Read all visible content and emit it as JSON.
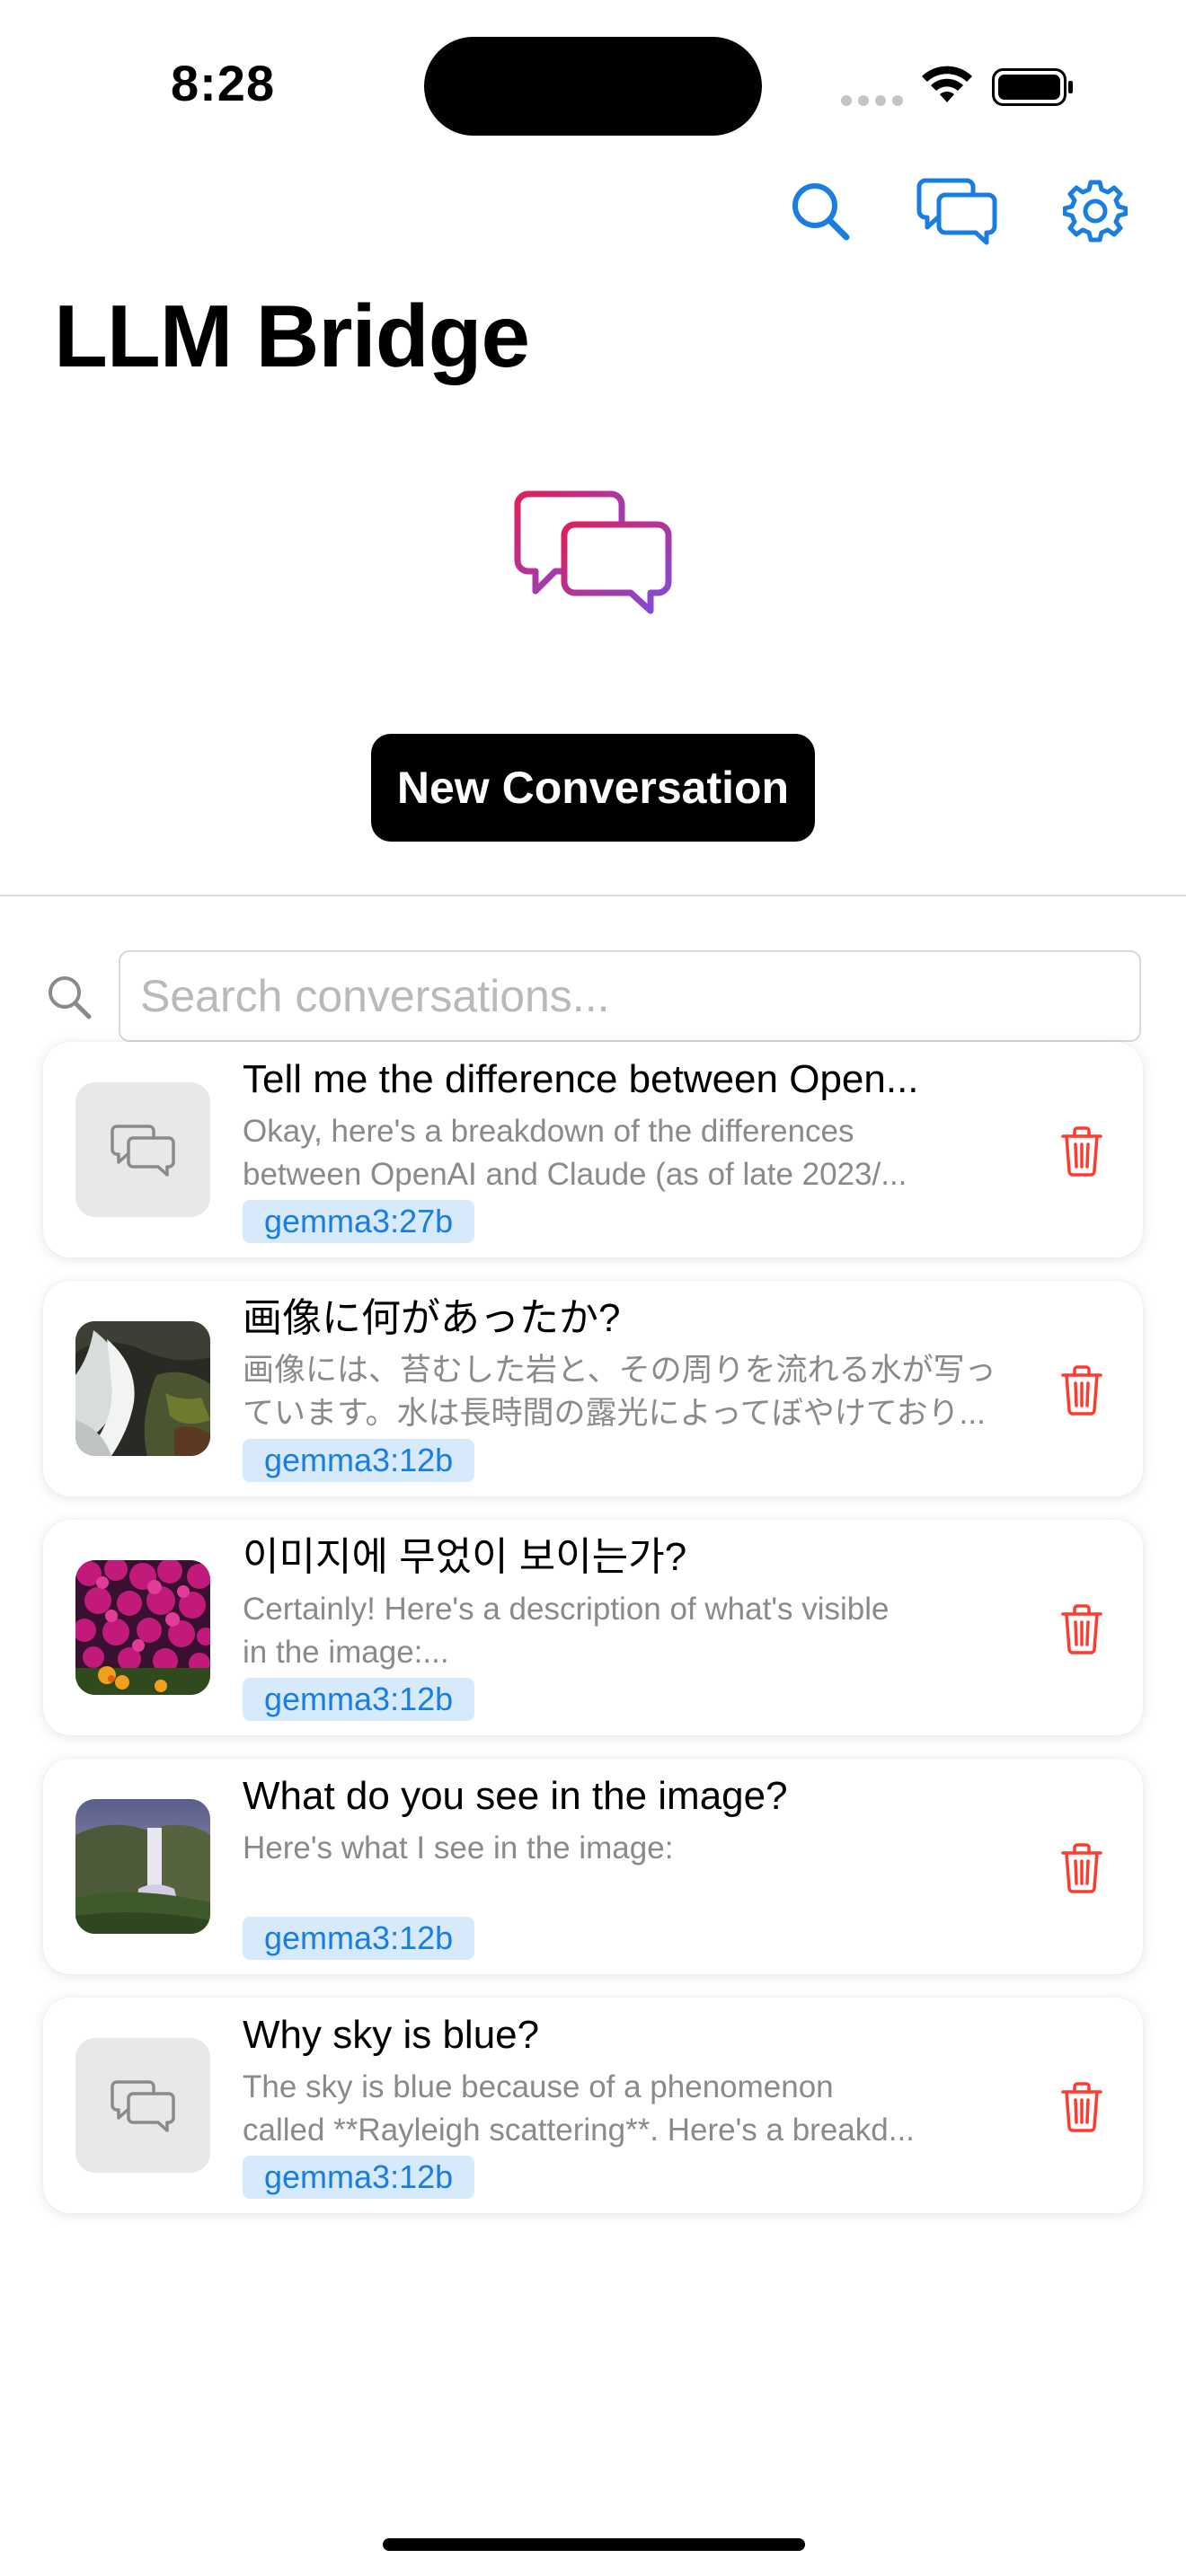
{
  "status_bar": {
    "time": "8:28"
  },
  "toolbar": {
    "search_icon": "search-icon",
    "chat_icon": "chat-bubbles-icon",
    "settings_icon": "gear-icon",
    "accent_color": "#1a7ee0"
  },
  "header": {
    "title": "LLM Bridge"
  },
  "hero": {
    "icon": "chat-bubbles-gradient-icon",
    "button_label": "New Conversation"
  },
  "search": {
    "placeholder": "Search conversations...",
    "value": ""
  },
  "conversations": [
    {
      "title": "Tell me the difference between Open...",
      "preview_line1": "Okay, here's a breakdown of the differences",
      "preview_line2": "between OpenAI and Claude (as of late 2023/...",
      "model": "gemma3:27b",
      "thumbnail": "chat-placeholder-icon"
    },
    {
      "title": "画像に何があったか?",
      "preview_line1": "画像には、苔むした岩と、その周りを流れる水が写っ",
      "preview_line2": "ています。水は長時間の露光によってぼやけており...",
      "model": "gemma3:12b",
      "thumbnail": "waterfall-rocks-photo"
    },
    {
      "title": "이미지에 무었이 보이는가?",
      "preview_line1": "Certainly! Here's a description of what's visible",
      "preview_line2": "in the image:...",
      "model": "gemma3:12b",
      "thumbnail": "pink-flowers-photo"
    },
    {
      "title": "What do you see in the image?",
      "preview_line1": "Here's what I see in the image:",
      "preview_line2": "",
      "model": "gemma3:12b",
      "thumbnail": "waterfall-landscape-photo"
    },
    {
      "title": "Why sky is blue?",
      "preview_line1": "The sky is blue because of a phenomenon",
      "preview_line2": "called **Rayleigh scattering**. Here's a breakd...",
      "model": "gemma3:12b",
      "thumbnail": "chat-placeholder-icon"
    }
  ],
  "colors": {
    "delete": "#ff3b30",
    "badge_bg": "#d7eafc",
    "badge_text": "#1a7ee0",
    "hero_gradient_start": "#e01e5a",
    "hero_gradient_end": "#7b4fe0"
  }
}
